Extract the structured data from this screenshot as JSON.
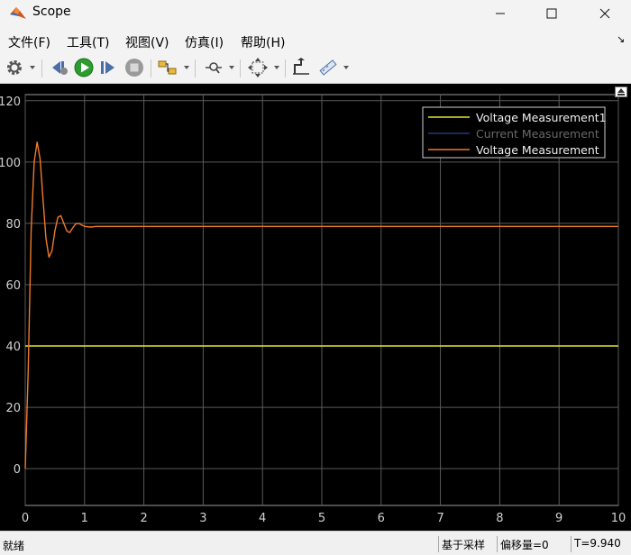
{
  "window": {
    "title": "Scope",
    "icon": "matlab-logo-icon",
    "controls": [
      "minimize-icon",
      "maximize-icon",
      "close-icon"
    ]
  },
  "menu": [
    {
      "label": "文件(F)"
    },
    {
      "label": "工具(T)"
    },
    {
      "label": "视图(V)"
    },
    {
      "label": "仿真(I)"
    },
    {
      "label": "帮助(H)"
    }
  ],
  "toolbar": {
    "buttons": [
      "settings-gear-icon",
      "step-back-icon",
      "run-icon",
      "step-forward-icon",
      "stop-icon",
      "signal-highlight-icon",
      "zoom-icon",
      "fit-axes-icon",
      "trigger-icon",
      "measure-icon"
    ],
    "colors": {
      "run": "#2e9b2e"
    }
  },
  "chart_data": {
    "type": "line",
    "xlim": [
      0,
      10
    ],
    "ylim": [
      -12,
      122
    ],
    "xticks": [
      0,
      1,
      2,
      3,
      4,
      5,
      6,
      7,
      8,
      9,
      10
    ],
    "yticks": [
      0,
      20,
      40,
      60,
      80,
      100,
      120
    ],
    "grid": true,
    "legend_position": "top-right",
    "background": "#000000",
    "series": [
      {
        "name": "Voltage Measurement1",
        "color": "#e6e62d",
        "x": [
          0,
          0.02,
          10
        ],
        "y": [
          40,
          40,
          40
        ]
      },
      {
        "name": "Current Measurement",
        "color": "#1f3a7a",
        "x": [],
        "y": []
      },
      {
        "name": "Voltage Measurement",
        "color": "#f07a28",
        "x": [
          0,
          0.05,
          0.1,
          0.15,
          0.2,
          0.25,
          0.3,
          0.35,
          0.4,
          0.45,
          0.5,
          0.55,
          0.6,
          0.65,
          0.7,
          0.75,
          0.8,
          0.85,
          0.9,
          0.95,
          1.0,
          1.1,
          1.2,
          1.3,
          1.5,
          2,
          3,
          4,
          5,
          6,
          7,
          8,
          9,
          10
        ],
        "y": [
          0,
          32,
          78,
          100,
          106.5,
          101,
          88,
          75,
          69,
          71,
          77.5,
          82,
          82.5,
          80,
          77.5,
          77,
          78.5,
          79.8,
          80,
          79.5,
          79,
          78.8,
          79,
          79,
          79,
          79,
          79,
          79,
          79,
          79,
          79,
          79,
          79,
          79
        ]
      }
    ]
  },
  "status": {
    "ready": "就绪",
    "mode": "基于采样",
    "offset": "偏移量=0",
    "time": "T=9.940"
  }
}
